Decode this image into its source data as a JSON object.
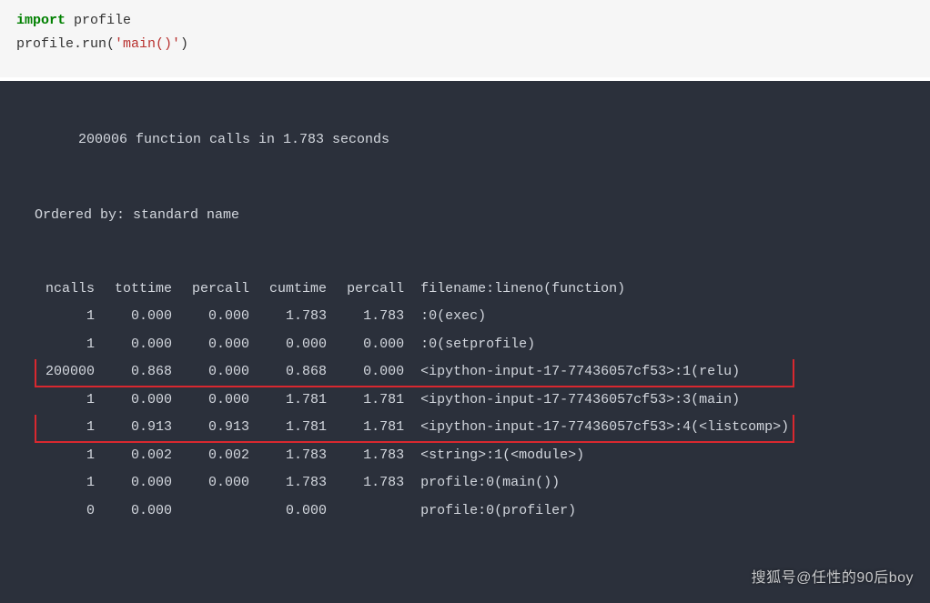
{
  "code": {
    "line1_kw": "import",
    "line1_rest": " profile",
    "line2_pre": "profile.run(",
    "line2_str": "'main()'",
    "line2_post": ")"
  },
  "output": {
    "summary": "200006 function calls in 1.783 seconds",
    "ordered": "Ordered by: standard name",
    "headers": {
      "ncalls": "ncalls",
      "tottime": "tottime",
      "percall1": "percall",
      "cumtime": "cumtime",
      "percall2": "percall",
      "filename": "filename:lineno(function)"
    },
    "rows": [
      {
        "ncalls": "1",
        "tottime": "0.000",
        "percall1": "0.000",
        "cumtime": "1.783",
        "percall2": "1.783",
        "fn": ":0(exec)",
        "hl": false
      },
      {
        "ncalls": "1",
        "tottime": "0.000",
        "percall1": "0.000",
        "cumtime": "0.000",
        "percall2": "0.000",
        "fn": ":0(setprofile)",
        "hl": false
      },
      {
        "ncalls": "200000",
        "tottime": "0.868",
        "percall1": "0.000",
        "cumtime": "0.868",
        "percall2": "0.000",
        "fn": "<ipython-input-17-77436057cf53>:1(relu)",
        "hl": true
      },
      {
        "ncalls": "1",
        "tottime": "0.000",
        "percall1": "0.000",
        "cumtime": "1.781",
        "percall2": "1.781",
        "fn": "<ipython-input-17-77436057cf53>:3(main)",
        "hl": false
      },
      {
        "ncalls": "1",
        "tottime": "0.913",
        "percall1": "0.913",
        "cumtime": "1.781",
        "percall2": "1.781",
        "fn": "<ipython-input-17-77436057cf53>:4(<listcomp>)",
        "hl": true
      },
      {
        "ncalls": "1",
        "tottime": "0.002",
        "percall1": "0.002",
        "cumtime": "1.783",
        "percall2": "1.783",
        "fn": "<string>:1(<module>)",
        "hl": false
      },
      {
        "ncalls": "1",
        "tottime": "0.000",
        "percall1": "0.000",
        "cumtime": "1.783",
        "percall2": "1.783",
        "fn": "profile:0(main())",
        "hl": false
      },
      {
        "ncalls": "0",
        "tottime": "0.000",
        "percall1": "",
        "cumtime": "0.000",
        "percall2": "",
        "fn": "profile:0(profiler)",
        "hl": false
      }
    ]
  },
  "watermark": "搜狐号@任性的90后boy"
}
